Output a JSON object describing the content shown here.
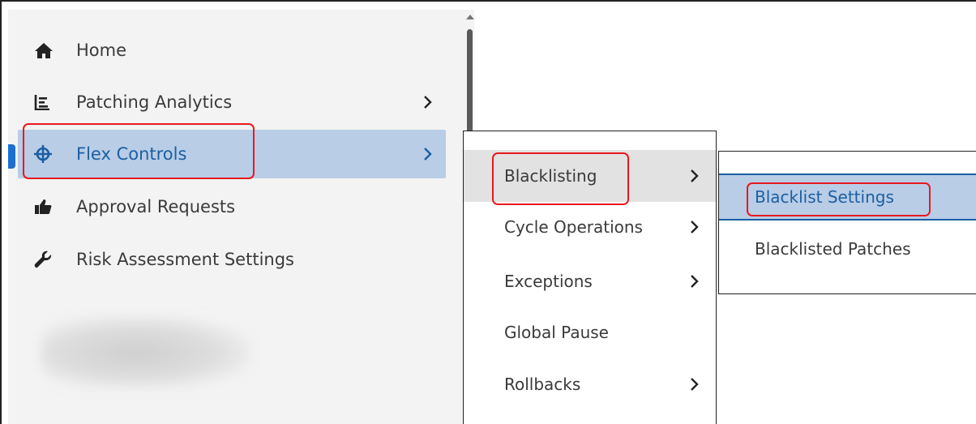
{
  "sidebar": {
    "items": [
      {
        "label": "Home",
        "icon": "home-icon",
        "has_submenu": false
      },
      {
        "label": "Patching Analytics",
        "icon": "analytics-icon",
        "has_submenu": true
      },
      {
        "label": "Flex Controls",
        "icon": "crosshair-icon",
        "has_submenu": true,
        "active": true
      },
      {
        "label": "Approval Requests",
        "icon": "thumbs-up-icon",
        "has_submenu": false
      },
      {
        "label": "Risk Assessment Settings",
        "icon": "wrench-icon",
        "has_submenu": false
      }
    ]
  },
  "submenu": {
    "items": [
      {
        "label": "Blacklisting",
        "has_submenu": true,
        "hover": true
      },
      {
        "label": "Cycle Operations",
        "has_submenu": true
      },
      {
        "label": "Exceptions",
        "has_submenu": true
      },
      {
        "label": "Global Pause",
        "has_submenu": false
      },
      {
        "label": "Rollbacks",
        "has_submenu": true
      }
    ]
  },
  "flyout": {
    "items": [
      {
        "label": "Blacklist Settings",
        "selected": true
      },
      {
        "label": "Blacklisted Patches"
      }
    ]
  },
  "colors": {
    "accent": "#1c5fa3",
    "active_bg": "#b9cde6",
    "highlight_box": "#e8191f"
  }
}
